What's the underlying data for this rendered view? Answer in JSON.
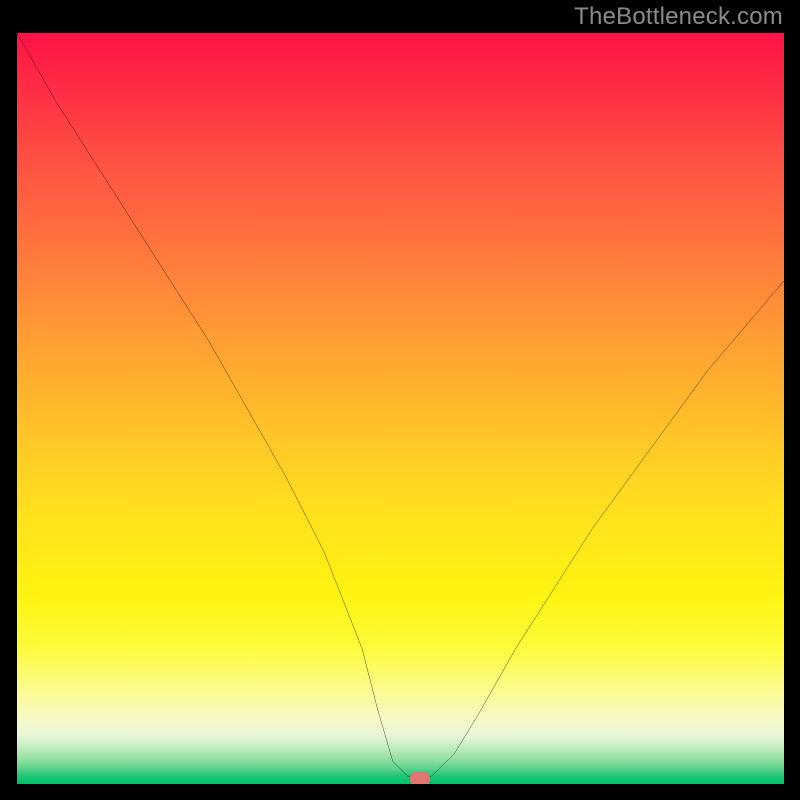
{
  "watermark": "TheBottleneck.com",
  "colors": {
    "frame": "#000000",
    "marker": "#e2766f",
    "curve": "#000000"
  },
  "chart_data": {
    "type": "line",
    "title": "",
    "xlabel": "",
    "ylabel": "",
    "xlim": [
      0,
      100
    ],
    "ylim": [
      0,
      100
    ],
    "grid": false,
    "series": [
      {
        "name": "bottleneck-curve",
        "x": [
          0,
          5,
          10,
          15,
          20,
          25,
          30,
          35,
          40,
          45,
          47,
          49,
          51,
          54,
          57,
          60,
          65,
          70,
          75,
          80,
          85,
          90,
          95,
          100
        ],
        "y": [
          100,
          91,
          83,
          75,
          67,
          59,
          50,
          41,
          31,
          18,
          10,
          3,
          1,
          1,
          4,
          9,
          18,
          26,
          34,
          41,
          48,
          55,
          61,
          67
        ]
      }
    ],
    "markers": [
      {
        "name": "optimum-point",
        "x": 52.5,
        "y": 0.7
      }
    ],
    "background_gradient_stops": [
      {
        "pos": 0,
        "color": "#ff1245"
      },
      {
        "pos": 25,
        "color": "#ff6a3f"
      },
      {
        "pos": 55,
        "color": "#ffc927"
      },
      {
        "pos": 82,
        "color": "#fcfb3c"
      },
      {
        "pos": 95,
        "color": "#c5eec1"
      },
      {
        "pos": 100,
        "color": "#00c06a"
      }
    ]
  }
}
